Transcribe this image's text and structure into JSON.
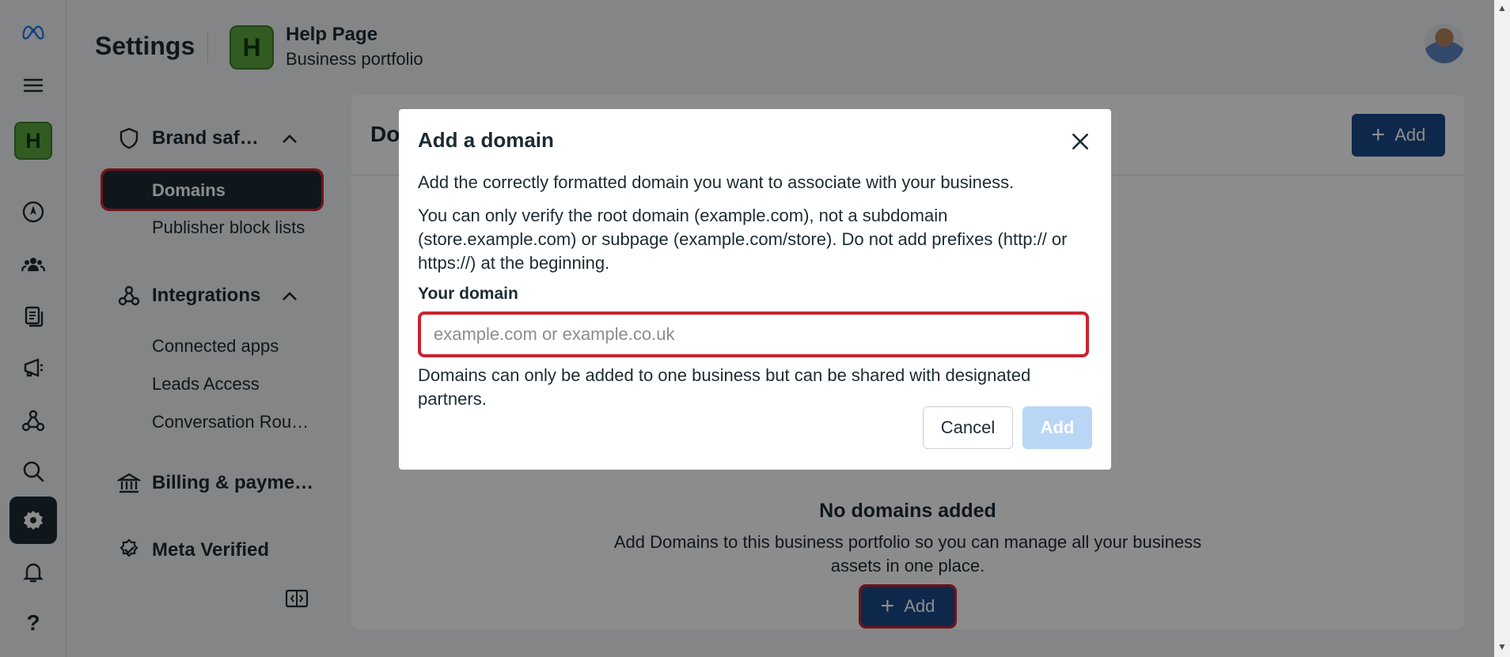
{
  "header": {
    "title": "Settings",
    "business_initial": "H",
    "business_name": "Help Page",
    "business_subtitle": "Business portfolio"
  },
  "rail": {
    "business_initial": "H",
    "icons": [
      "meta-logo-icon",
      "menu-icon",
      "compass-icon",
      "people-icon",
      "pages-icon",
      "ads-icon",
      "network-icon",
      "search-icon",
      "settings-icon",
      "bell-icon",
      "help-icon"
    ],
    "help_glyph": "?"
  },
  "subnav": {
    "brand_safety": "Brand saf…",
    "domains": "Domains",
    "publisher_block_lists": "Publisher block lists",
    "integrations": "Integrations",
    "connected_apps": "Connected apps",
    "leads_access": "Leads Access",
    "conversation_routing": "Conversation Rou…",
    "billing": "Billing & payme…",
    "meta_verified": "Meta Verified"
  },
  "panel": {
    "title_partial": "Do",
    "add_label": "Add",
    "empty_title": "No domains added",
    "empty_desc": "Add Domains to this business portfolio so you can manage all your business assets in one place.",
    "empty_add_label": "Add"
  },
  "modal": {
    "title": "Add a domain",
    "intro": "Add the correctly formatted domain you want to associate with your business.",
    "rules": "You can only verify the root domain (example.com), not a subdomain (store.example.com) or subpage (example.com/store). Do not add prefixes (http:// or https://) at the beginning.",
    "field_label": "Your domain",
    "field_placeholder": "example.com or example.co.uk",
    "field_value": "",
    "note": "Domains can only be added to one business but can be shared with designated partners.",
    "cancel_label": "Cancel",
    "add_label": "Add"
  },
  "colors": {
    "primary": "#1b4a8a",
    "dark": "#1c2b33",
    "highlight": "#c8242f",
    "disabled": "#b9d7f5",
    "brand_green": "#5ba63f"
  }
}
